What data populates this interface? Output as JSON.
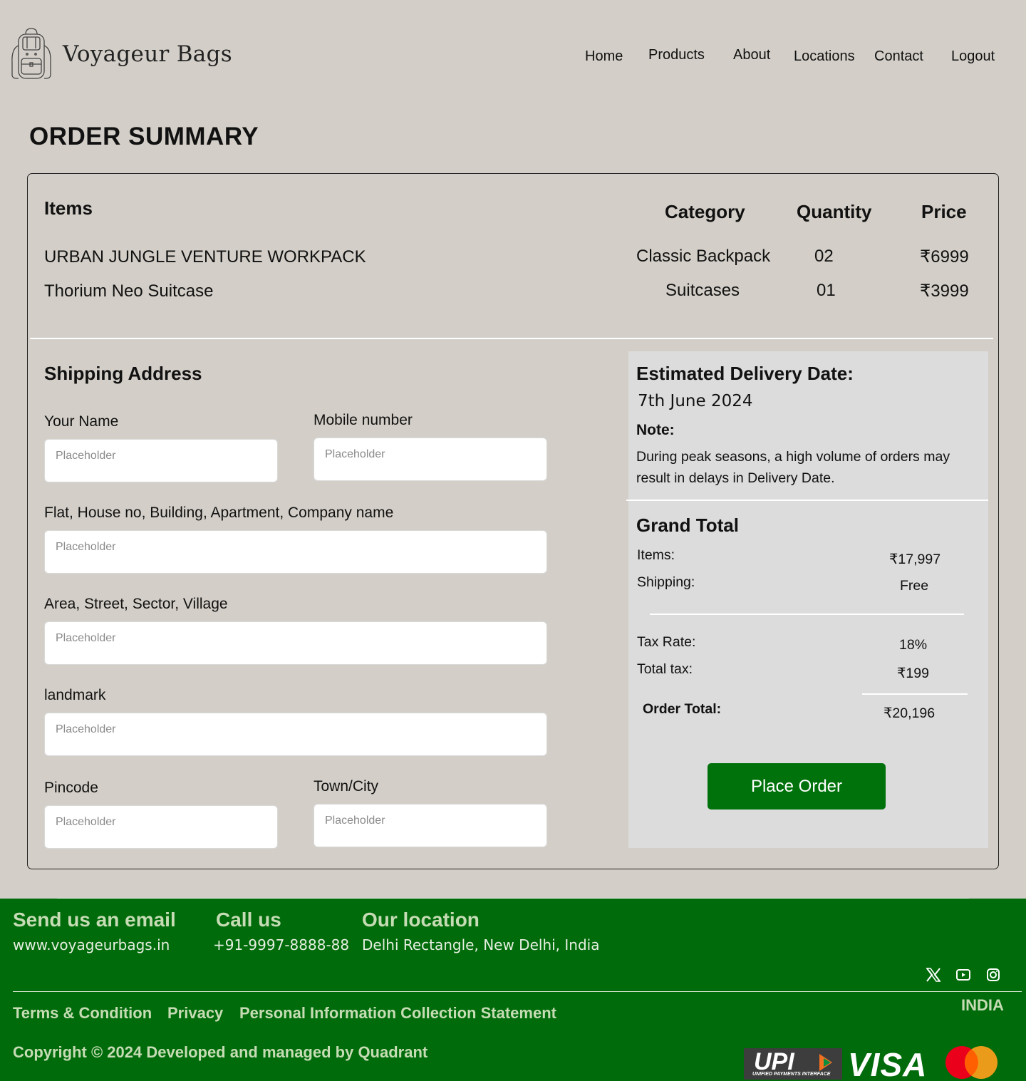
{
  "brand": {
    "name": "Voyageur Bags",
    "logo_icon": "backpack-icon"
  },
  "nav": {
    "home": "Home",
    "products": "Products",
    "about": "About",
    "locations": "Locations",
    "contact": "Contact",
    "logout": "Logout"
  },
  "page_title": "ORDER SUMMARY",
  "table": {
    "headers": {
      "items": "Items",
      "category": "Category",
      "quantity": "Quantity",
      "price": "Price"
    },
    "rows": [
      {
        "item": "URBAN JUNGLE VENTURE WORKPACK",
        "category": "Classic Backpack",
        "quantity": "02",
        "price": "₹6999"
      },
      {
        "item": "Thorium Neo Suitcase",
        "category": "Suitcases",
        "quantity": "01",
        "price": "₹3999"
      }
    ]
  },
  "shipping": {
    "title": "Shipping Address",
    "name_label": "Your Name",
    "mobile_label": "Mobile number",
    "flat_label": "Flat, House no, Building, Apartment,  Company name",
    "area_label": "Area, Street, Sector, Village",
    "landmark_label": "landmark",
    "pincode_label": "Pincode",
    "city_label": "Town/City",
    "placeholder": "Placeholder"
  },
  "delivery": {
    "title": "Estimated Delivery Date:",
    "date": "7th June 2024",
    "note_label": "Note:",
    "note_line1": "During peak seasons, a high volume of orders may",
    "note_line2": "result in delays in Delivery Date."
  },
  "totals": {
    "title": "Grand Total",
    "items_label": "Items:",
    "items_value": "₹17,997",
    "shipping_label": "Shipping:",
    "shipping_value": "Free",
    "tax_rate_label": "Tax Rate:",
    "tax_rate_value": "18%",
    "total_tax_label": "Total tax:",
    "total_tax_value": "₹199",
    "order_total_label": "Order Total:",
    "order_total_value": "₹20,196"
  },
  "place_order": "Place Order",
  "footer": {
    "email_heading": "Send us an email",
    "email_value": "www.voyageurbags.in",
    "call_heading": "Call us",
    "call_value": "+91-9997-8888-88",
    "location_heading": "Our location",
    "location_value": "Delhi Rectangle, New Delhi, India",
    "terms": "Terms & Condition",
    "privacy": "Privacy",
    "pics": "Personal Information Collection Statement",
    "country": "INDIA",
    "copyright": "Copyright © 2024 Developed and managed by Quadrant",
    "social_icons": [
      "x-twitter-icon",
      "youtube-icon",
      "instagram-icon"
    ],
    "payment": {
      "upi_text": "UPI",
      "upi_subtext": "UNIFIED PAYMENTS INTERFACE",
      "visa_text": "VISA",
      "mastercard_icon": "mastercard-icon"
    }
  },
  "colors": {
    "background": "#d3cfc8",
    "footer": "#006b0b",
    "button": "#00720b",
    "panel": "#dcdcdc"
  }
}
